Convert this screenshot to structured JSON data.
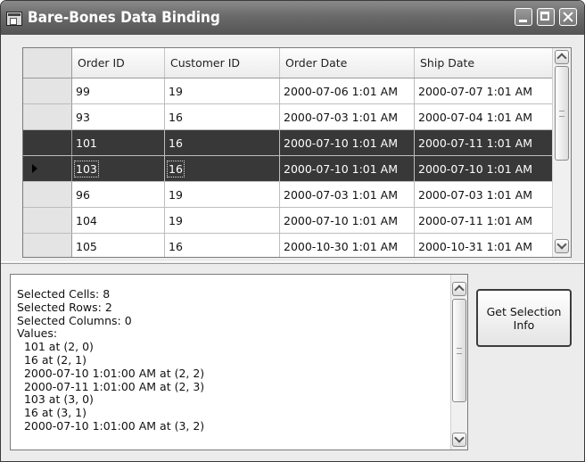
{
  "window": {
    "title": "Bare-Bones Data Binding"
  },
  "grid": {
    "columns": [
      "Order ID",
      "Customer ID",
      "Order Date",
      "Ship Date"
    ],
    "rows": [
      {
        "cells": [
          "99",
          "19",
          "2000-07-06 1:01 AM",
          "2000-07-07 1:01 AM"
        ],
        "selected": false,
        "current": false
      },
      {
        "cells": [
          "93",
          "16",
          "2000-07-03 1:01 AM",
          "2000-07-04 1:01 AM"
        ],
        "selected": false,
        "current": false
      },
      {
        "cells": [
          "101",
          "16",
          "2000-07-10 1:01 AM",
          "2000-07-11 1:01 AM"
        ],
        "selected": true,
        "current": false
      },
      {
        "cells": [
          "103",
          "16",
          "2000-07-10 1:01 AM",
          "2000-07-10 1:01 AM"
        ],
        "selected": true,
        "current": true
      },
      {
        "cells": [
          "96",
          "19",
          "2000-07-03 1:01 AM",
          "2000-07-03 1:01 AM"
        ],
        "selected": false,
        "current": false
      },
      {
        "cells": [
          "104",
          "19",
          "2000-07-10 1:01 AM",
          "2000-07-11 1:01 AM"
        ],
        "selected": false,
        "current": false
      },
      {
        "cells": [
          "105",
          "16",
          "2000-10-30 1:01 AM",
          "2000-10-31 1:01 AM"
        ],
        "selected": false,
        "current": false
      }
    ]
  },
  "info": {
    "lines": [
      "Selected Cells: 8",
      "Selected Rows: 2",
      "Selected Columns: 0",
      "Values:",
      "  101 at (2, 0)",
      "  16 at (2, 1)",
      "  2000-07-10 1:01:00 AM at (2, 2)",
      "  2000-07-11 1:01:00 AM at (2, 3)",
      "  103 at (3, 0)",
      "  16 at (3, 1)",
      "  2000-07-10 1:01:00 AM at (3, 2)"
    ]
  },
  "buttons": {
    "get_selection_info": "Get Selection Info"
  },
  "colors": {
    "selection": "#383838",
    "titlebar": "#6a6a6a"
  }
}
